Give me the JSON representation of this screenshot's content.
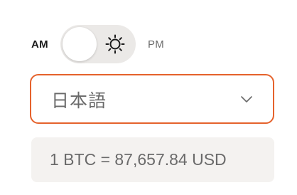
{
  "time_toggle": {
    "am_label": "AM",
    "pm_label": "PM",
    "icon": "sun-icon",
    "state": "AM"
  },
  "language_select": {
    "selected": "日本語",
    "icon": "chevron-down-icon",
    "border_color": "#e5622c"
  },
  "rate": {
    "text": "1 BTC = 87,657.84 USD"
  },
  "colors": {
    "accent": "#e5622c",
    "switch_track": "#ebe9e7",
    "rate_background": "#f4f2f0"
  }
}
